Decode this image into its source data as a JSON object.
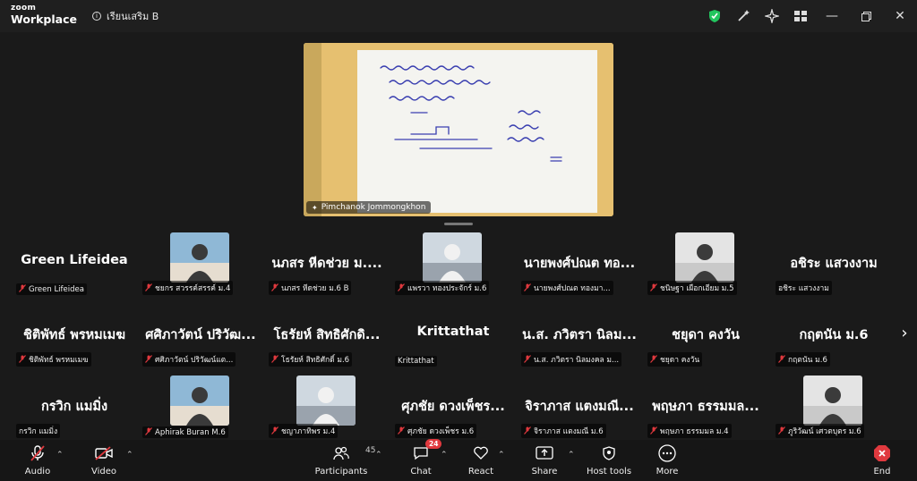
{
  "app": {
    "logo_top": "zoom",
    "logo_bottom": "Workplace",
    "meeting_title": "เรียนเสริม B"
  },
  "share": {
    "presenter": "Pimchanok Jommongkhon"
  },
  "participants": [
    {
      "big": "Green Lifeidea",
      "label": "Green Lifeidea",
      "muted": true
    },
    {
      "big": "",
      "label": "ชยกร สวรรค์สรรค์ ม.4",
      "muted": true,
      "video": true
    },
    {
      "big": "นภสร หีดช่วย ม....",
      "label": "นภสร หีดช่วย ม.6 B",
      "muted": true
    },
    {
      "big": "",
      "label": "แพรวา ทองประจักร์ ม.6",
      "muted": true,
      "video": true
    },
    {
      "big": "นายพงศ์ปณต ทอ...",
      "label": "นายพงศ์ปณต ทองมา...",
      "muted": true
    },
    {
      "big": "",
      "label": "ชนิษฐา เผือกเอียม ม.5",
      "muted": true,
      "video": true
    },
    {
      "big": "อชิระ แสวงงาม",
      "label": "อชิระ แสวงงาม",
      "muted": false
    },
    {
      "big": "ชิติพัทธ์ พรหมเมฆ",
      "label": "ชิติพัทธ์ พรหมเมฆ",
      "muted": true
    },
    {
      "big": "ศศิภาวัตน์ ปริวัฒ...",
      "label": "ศศิภาวัตน์ ปริวัฒน์แต...",
      "muted": true
    },
    {
      "big": "โธรัยห์ สิทธิศักดิ...",
      "label": "โธรัยห์ สิทธิศักดิ์ ม.6",
      "muted": true
    },
    {
      "big": "Krittathat",
      "label": "Krittathat",
      "muted": false
    },
    {
      "big": "น.ส. ภวิตรา นิลม...",
      "label": "น.ส. ภวิตรา นิลมงคล ม...",
      "muted": true
    },
    {
      "big": "ชยุดา คงวัน",
      "label": "ชยุดา คงวัน",
      "muted": true
    },
    {
      "big": "กฤตนัน ม.6",
      "label": "กฤตนัน ม.6",
      "muted": true
    },
    {
      "big": "กรวิก แมมิ่ง",
      "label": "กรวิก แมมิ่ง",
      "muted": false
    },
    {
      "big": "",
      "label": "Aphirak Buran M.6",
      "muted": true,
      "video": true
    },
    {
      "big": "",
      "label": "ชญาภาทิพร ม.4",
      "muted": true,
      "video": true
    },
    {
      "big": "ศุภชัย ดวงเพ็ชร...",
      "label": "ศุภชัย ดวงเพ็ชร ม.6",
      "muted": true
    },
    {
      "big": "จิราภาส แตงมณี...",
      "label": "จิราภาส แตงมณี ม.6",
      "muted": true
    },
    {
      "big": "พฤษภา ธรรมมล...",
      "label": "พฤษภา ธรรมมล ม.4",
      "muted": true
    },
    {
      "big": "",
      "label": "ภูริวัฒน์ เศวตบุตร ม.6",
      "muted": true,
      "video": true
    }
  ],
  "toolbar": {
    "audio": "Audio",
    "video": "Video",
    "participants": "Participants",
    "participants_count": "45",
    "chat": "Chat",
    "chat_badge": "24",
    "react": "React",
    "share": "Share",
    "host_tools": "Host tools",
    "more": "More",
    "end": "End"
  }
}
